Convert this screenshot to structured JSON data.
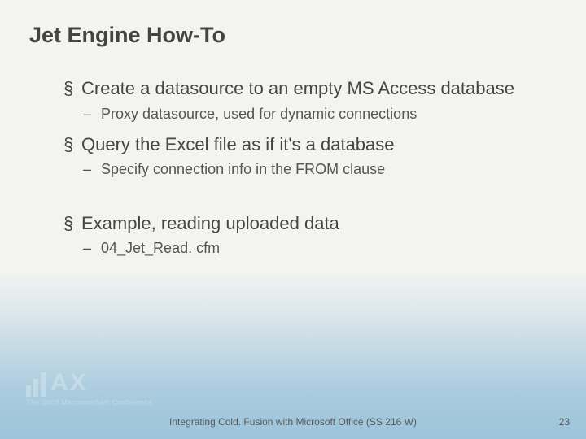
{
  "title": "Jet Engine How-To",
  "bullets": [
    {
      "level": 1,
      "text": "Create a datasource to an empty MS Access database"
    },
    {
      "level": 2,
      "text": "Proxy datasource, used for dynamic connections"
    },
    {
      "level": 1,
      "text": "Query the Excel file as if it's a database"
    },
    {
      "level": 2,
      "text": "Specify connection info in the FROM clause"
    },
    {
      "level": 0,
      "text": ""
    },
    {
      "level": 1,
      "text": "Example, reading uploaded data"
    },
    {
      "level": 2,
      "text": "04_Jet_Read. cfm",
      "link": true
    }
  ],
  "footer": "Integrating Cold. Fusion with Microsoft Office (SS 216 W)",
  "page_number": "23",
  "logo": {
    "text": "AX",
    "subtitle": "The 2003 Macromedia® Conference"
  }
}
